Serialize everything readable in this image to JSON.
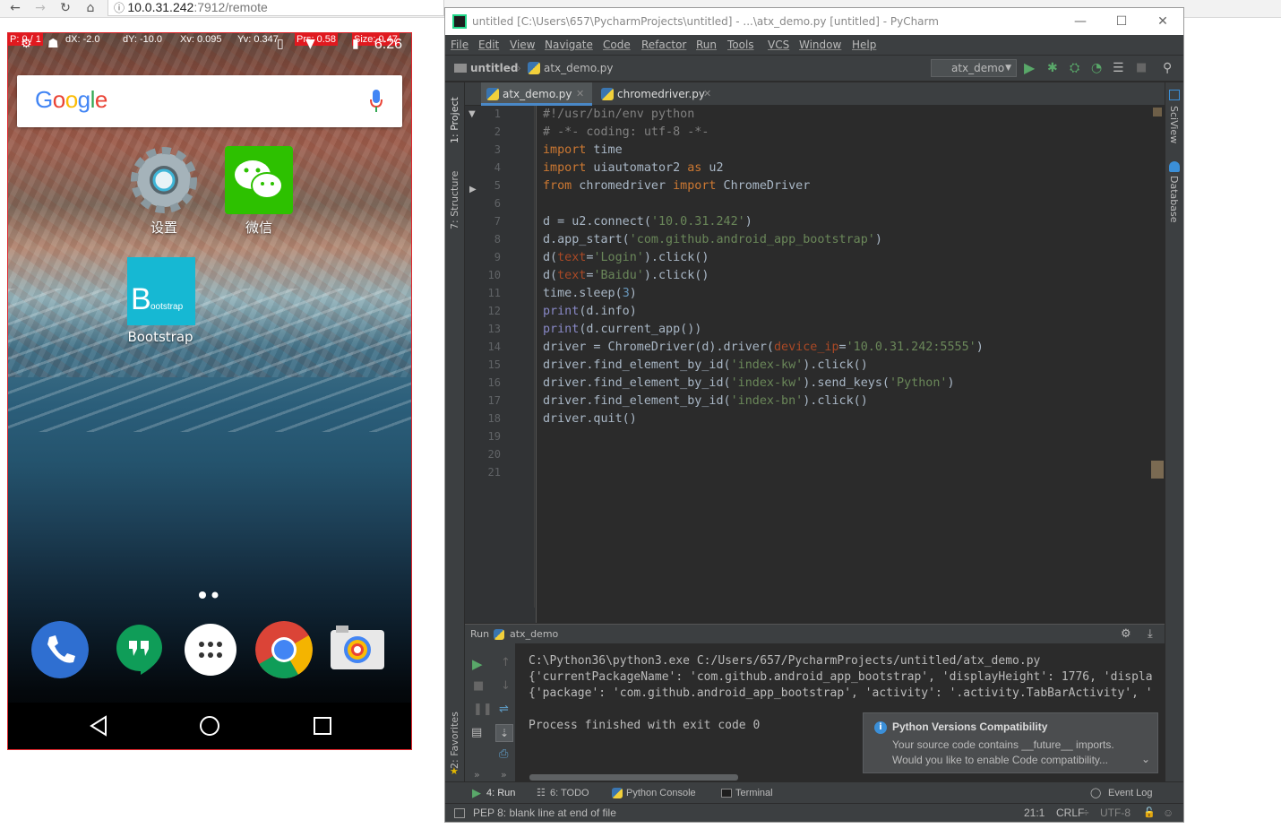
{
  "browser": {
    "url_host": "10.0.31.242",
    "url_path": ":7912/remote"
  },
  "phone": {
    "debug": {
      "p": "P: 0 / 1",
      "dx": "dX: -2.0",
      "dy": "dY: -10.0",
      "xv": "Xv: 0.095",
      "yv": "Yv: 0.347",
      "prs": "Prs: 0.58",
      "size": "Size: 0.47"
    },
    "time": "6:26",
    "google_logo": "Google",
    "apps": [
      {
        "label": "设置",
        "icon": "settings-gear-icon"
      },
      {
        "label": "微信",
        "icon": "wechat-icon"
      },
      {
        "label": "Bootstrap",
        "icon": "bootstrap-icon"
      }
    ],
    "bootstrap_glyph": "B",
    "bootstrap_sub": "ootstrap",
    "dock": [
      "phone-icon",
      "hangouts-icon",
      "app-drawer-icon",
      "chrome-icon",
      "camera-icon"
    ],
    "navbar": [
      "back-icon",
      "home-icon",
      "recents-icon"
    ]
  },
  "ide": {
    "title": "untitled [C:\\Users\\657\\PycharmProjects\\untitled] - ...\\atx_demo.py [untitled] - PyCharm",
    "menu": [
      "File",
      "Edit",
      "View",
      "Navigate",
      "Code",
      "Refactor",
      "Run",
      "Tools",
      "VCS",
      "Window",
      "Help"
    ],
    "breadcrumb": {
      "project": "untitled",
      "file": "atx_demo.py"
    },
    "run_config": "atx_demo",
    "tabs": [
      {
        "label": "atx_demo.py",
        "active": true
      },
      {
        "label": "chromedriver.py",
        "active": false
      }
    ],
    "left_tools": [
      "1: Project",
      "7: Structure",
      "2: Favorites"
    ],
    "right_tools": [
      "SciView",
      "Database"
    ],
    "line_numbers": [
      "1",
      "2",
      "3",
      "4",
      "5",
      "6",
      "7",
      "8",
      "9",
      "10",
      "11",
      "12",
      "13",
      "14",
      "15",
      "16",
      "17",
      "18",
      "19",
      "20",
      "21"
    ],
    "run": {
      "header_label": "Run",
      "config": "atx_demo",
      "lines": [
        "C:\\Python36\\python3.exe C:/Users/657/PycharmProjects/untitled/atx_demo.py",
        "{'currentPackageName': 'com.github.android_app_bootstrap', 'displayHeight': 1776, 'displa",
        "{'package': 'com.github.android_app_bootstrap', 'activity': '.activity.TabBarActivity', '",
        "",
        "Process finished with exit code 0"
      ]
    },
    "notification": {
      "title": "Python Versions Compatibility",
      "line1": "Your source code contains __future__ imports.",
      "line2": "Would you like to enable Code compatibility..."
    },
    "toolbar": {
      "run": "4: Run",
      "todo": "6: TODO",
      "console": "Python Console",
      "terminal": "Terminal",
      "event_log": "Event Log"
    },
    "status": {
      "message": "PEP 8: blank line at end of file",
      "position": "21:1",
      "line_sep": "CRLF",
      "encoding": "UTF-8"
    },
    "colors": {
      "keyword": "#cc7832",
      "string": "#6a8759",
      "comment": "#808080",
      "editor_bg": "#2b2b2b"
    }
  }
}
